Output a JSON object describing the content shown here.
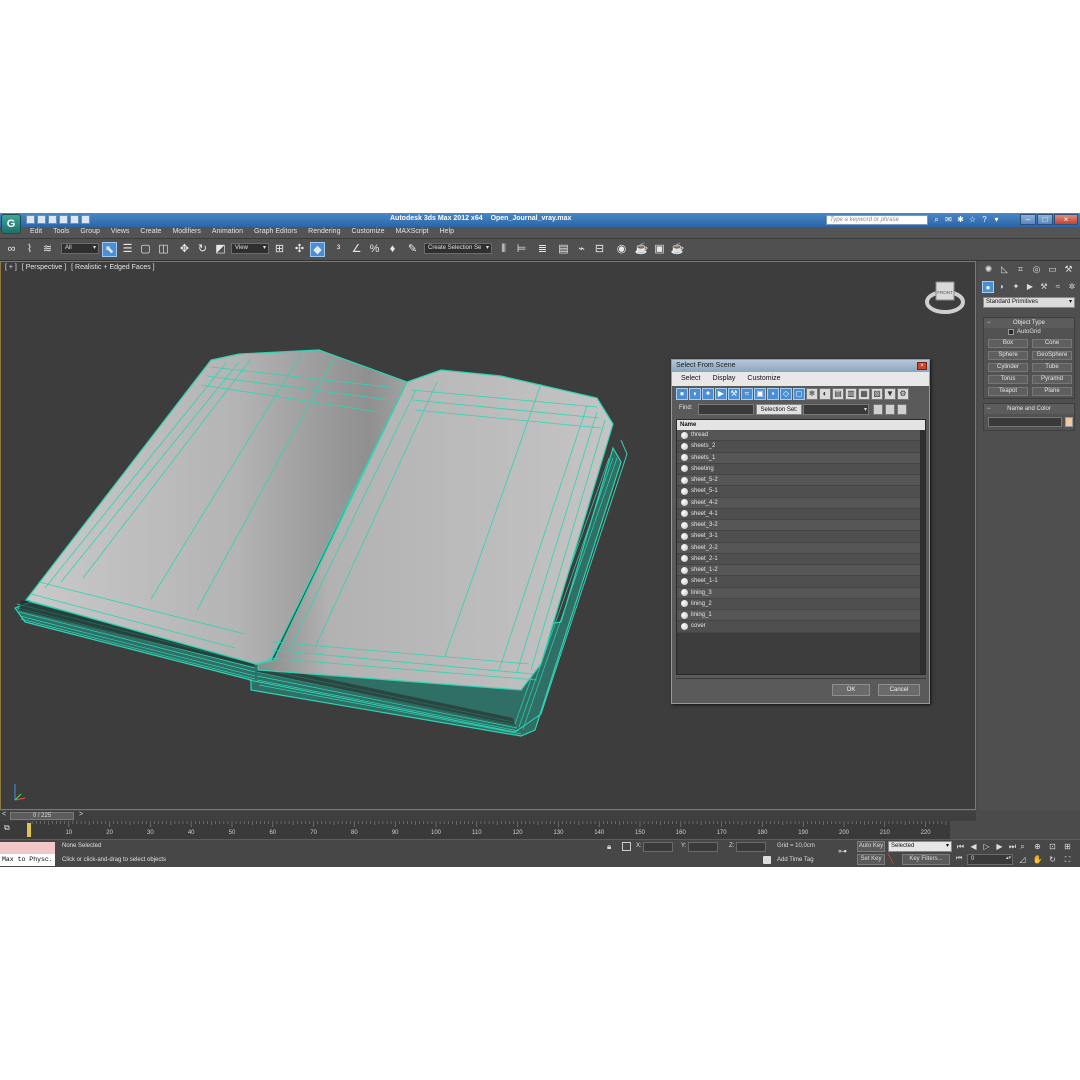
{
  "app": {
    "logo_letter": "G",
    "title": "Autodesk 3ds Max  2012 x64",
    "file_name": "Open_Journal_vray.max",
    "search_placeholder": "Type a keyword or phrase"
  },
  "menu": [
    "Edit",
    "Tools",
    "Group",
    "Views",
    "Create",
    "Modifiers",
    "Animation",
    "Graph Editors",
    "Rendering",
    "Customize",
    "MAXScript",
    "Help"
  ],
  "toolbar": {
    "selection_filter": "All",
    "ref_coord": "View",
    "named_selection_set": "Create Selection Se"
  },
  "viewport": {
    "labels": [
      "[ + ]",
      "[ Perspective ]",
      "[ Realistic + Edged Faces ]"
    ],
    "wire_color": "#2dd4b4",
    "border_color": "#8c7a3e",
    "viewcube_label": "FRONT"
  },
  "dialog": {
    "title": "Select From Scene",
    "menu": [
      "Select",
      "Display",
      "Customize"
    ],
    "find_label": "Find:",
    "selection_set_label": "Selection Set:",
    "column_header": "Name",
    "items": [
      "thread",
      "sheets_2",
      "sheets_1",
      "sheeting",
      "sheet_5-2",
      "sheet_5-1",
      "sheet_4-2",
      "sheet_4-1",
      "sheet_3-2",
      "sheet_3-1",
      "sheet_2-2",
      "sheet_2-1",
      "sheet_1-2",
      "sheet_1-1",
      "lining_3",
      "lining_2",
      "lining_1",
      "cover"
    ],
    "ok_label": "OK",
    "cancel_label": "Cancel"
  },
  "command_panel": {
    "category_dropdown": "Standard Primitives",
    "object_type_title": "Object Type",
    "autogrid_label": "AutoGrid",
    "object_buttons": [
      "Box",
      "Cone",
      "Sphere",
      "GeoSphere",
      "Cylinder",
      "Tube",
      "Torus",
      "Pyramid",
      "Teapot",
      "Plane"
    ],
    "name_color_title": "Name and Color",
    "color_swatch": "#f1c9a3"
  },
  "timeline": {
    "left_arrow": "<",
    "slider_text": "0 / 225",
    "right_arrow": ">",
    "ticks": [
      "0",
      "10",
      "20",
      "30",
      "40",
      "50",
      "60",
      "70",
      "80",
      "90",
      "100",
      "110",
      "120",
      "130",
      "140",
      "150",
      "160",
      "170",
      "180",
      "190",
      "200",
      "210",
      "220"
    ]
  },
  "status": {
    "maxscript_text": "Max to Physc.",
    "selection": "None Selected",
    "prompt": "Click or click-and-drag to select objects",
    "x_label": "X:",
    "y_label": "Y:",
    "z_label": "Z:",
    "grid": "Grid = 10,0cm",
    "add_time_tag": "Add Time Tag",
    "auto_key": "Auto Key",
    "set_key": "Set Key",
    "key_mode": "Selected",
    "key_filters": "Key Filters...",
    "current_frame": "0"
  }
}
